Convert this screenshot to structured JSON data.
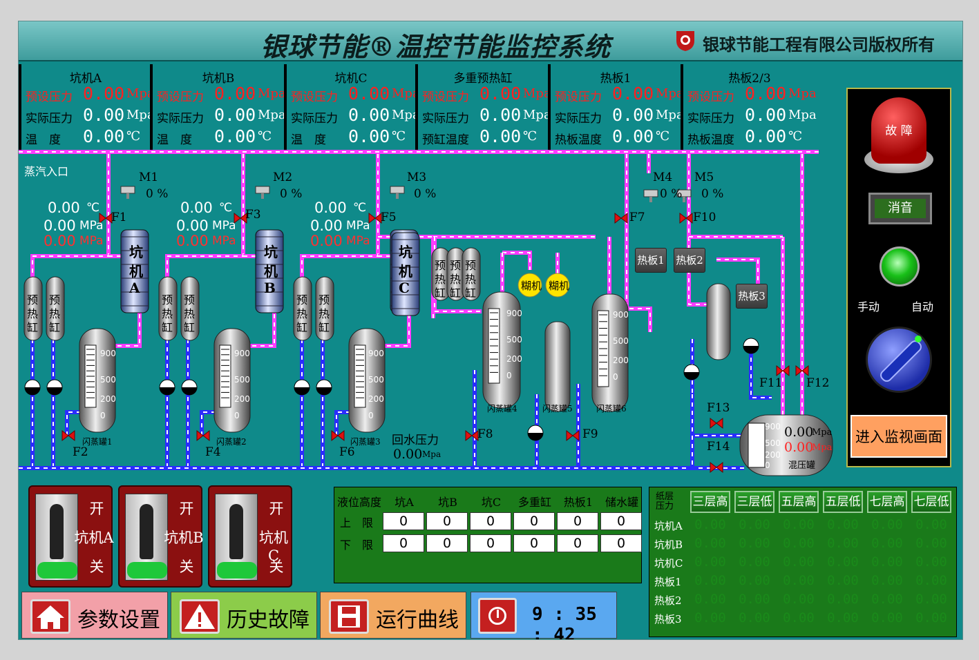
{
  "title": "银球节能®温控节能监控系统",
  "copyright": "银球节能工程有限公司版权所有",
  "panels": [
    {
      "name": "坑机A",
      "r1": "预设压力",
      "v1": "0.00",
      "u1": "Mpa",
      "r2": "实际压力",
      "v2": "0.00",
      "u2": "Mpa",
      "r3": "温　度",
      "v3": "0.00",
      "u3": "℃"
    },
    {
      "name": "坑机B",
      "r1": "预设压力",
      "v1": "0.00",
      "u1": "Mpa",
      "r2": "实际压力",
      "v2": "0.00",
      "u2": "Mpa",
      "r3": "温　度",
      "v3": "0.00",
      "u3": "℃"
    },
    {
      "name": "坑机C",
      "r1": "预设压力",
      "v1": "0.00",
      "u1": "Mpa",
      "r2": "实际压力",
      "v2": "0.00",
      "u2": "Mpa",
      "r3": "温　度",
      "v3": "0.00",
      "u3": "℃"
    },
    {
      "name": "多重预热缸",
      "r1": "预设压力",
      "v1": "0.00",
      "u1": "Mpa",
      "r2": "实际压力",
      "v2": "0.00",
      "u2": "Mpa",
      "r3": "预缸温度",
      "v3": "0.00",
      "u3": "℃"
    },
    {
      "name": "热板1",
      "r1": "预设压力",
      "v1": "0.00",
      "u1": "Mpa",
      "r2": "实际压力",
      "v2": "0.00",
      "u2": "Mpa",
      "r3": "热板温度",
      "v3": "0.00",
      "u3": "℃"
    },
    {
      "name": "热板2/3",
      "r1": "预设压力",
      "v1": "0.00",
      "u1": "Mpa",
      "r2": "实际压力",
      "v2": "0.00",
      "u2": "Mpa",
      "r3": "热板温度",
      "v3": "0.00",
      "u3": "℃"
    }
  ],
  "process": {
    "steam_inlet": "蒸汽入口",
    "motors": [
      {
        "name": "M1",
        "pct": "0 %"
      },
      {
        "name": "M2",
        "pct": "0 %"
      },
      {
        "name": "M3",
        "pct": "0 %"
      },
      {
        "name": "M4",
        "pct": "0 %"
      },
      {
        "name": "M5",
        "pct": "0 %"
      }
    ],
    "valves": [
      "F1",
      "F2",
      "F3",
      "F4",
      "F5",
      "F6",
      "F7",
      "F8",
      "F9",
      "F10",
      "F11",
      "F12",
      "F13",
      "F14"
    ],
    "readouts": [
      {
        "t": "0.00",
        "tu": "℃",
        "p": "0.00",
        "pu": "MPa",
        "s": "0.00",
        "su": "MPa"
      },
      {
        "t": "0.00",
        "tu": "℃",
        "p": "0.00",
        "pu": "MPa",
        "s": "0.00",
        "su": "MPa"
      },
      {
        "t": "0.00",
        "tu": "℃",
        "p": "0.00",
        "pu": "MPa",
        "s": "0.00",
        "su": "MPa"
      }
    ],
    "pit_labels": [
      [
        "坑",
        "机",
        "A"
      ],
      [
        "坑",
        "机",
        "B"
      ],
      [
        "坑",
        "机",
        "C"
      ]
    ],
    "preheat_label": [
      "预",
      "热",
      "缸"
    ],
    "flash_tanks": [
      "闪蒸罐1",
      "闪蒸罐2",
      "闪蒸罐3",
      "闪蒸罐4",
      "闪蒸罐5",
      "闪蒸罐6"
    ],
    "gauge_ticks": [
      "900",
      "500",
      "200",
      "0"
    ],
    "paste_machine": "糊机",
    "hotplates": [
      "热板1",
      "热板2",
      "热板3"
    ],
    "return_label": "回水压力",
    "return_value": "0.00",
    "return_unit": "Mpa",
    "mix_tank": {
      "name": "混压罐",
      "v1": "0.00",
      "u1": "Mpa",
      "v2": "0.00",
      "u2": "Mpa"
    }
  },
  "right_panel": {
    "fault_label": "故 障",
    "mute_label": "消音",
    "manual_label": "手动",
    "auto_label": "自动",
    "enter_label": "进入监视画面"
  },
  "switches": [
    {
      "on": "开",
      "name": "坑机A",
      "off": "关"
    },
    {
      "on": "开",
      "name": "坑机B",
      "off": "关"
    },
    {
      "on": "开",
      "name": "坑机C",
      "off": "关"
    }
  ],
  "level_table": {
    "title": "液位高度",
    "columns": [
      "坑A",
      "坑B",
      "坑C",
      "多重缸罐",
      "热板1",
      "储水罐"
    ],
    "rows": [
      {
        "label": "上　限",
        "values": [
          "0",
          "0",
          "0",
          "0",
          "0",
          "0"
        ]
      },
      {
        "label": "下　限",
        "values": [
          "0",
          "0",
          "0",
          "0",
          "0",
          "0"
        ]
      }
    ]
  },
  "pressure_table": {
    "title": "纸层压力",
    "columns": [
      "三层高",
      "三层低",
      "五层高",
      "五层低",
      "七层高",
      "七层低"
    ],
    "rows": [
      {
        "label": "坑机A",
        "values": [
          "0.00",
          "0.00",
          "0.00",
          "0.00",
          "0.00",
          "0.00"
        ]
      },
      {
        "label": "坑机B",
        "values": [
          "0.00",
          "0.00",
          "0.00",
          "0.00",
          "0.00",
          "0.00"
        ]
      },
      {
        "label": "坑机C",
        "values": [
          "0.00",
          "0.00",
          "0.00",
          "0.00",
          "0.00",
          "0.00"
        ]
      },
      {
        "label": "热板1",
        "values": [
          "0.00",
          "0.00",
          "0.00",
          "0.00",
          "0.00",
          "0.00"
        ]
      },
      {
        "label": "热板2",
        "values": [
          "0.00",
          "0.00",
          "0.00",
          "0.00",
          "0.00",
          "0.00"
        ]
      },
      {
        "label": "热板3",
        "values": [
          "0.00",
          "0.00",
          "0.00",
          "0.00",
          "0.00",
          "0.00"
        ]
      }
    ]
  },
  "nav": [
    {
      "label": "参数设置",
      "icon": "home-icon",
      "bg": "#f2a0a8"
    },
    {
      "label": "历史故障",
      "icon": "warning-icon",
      "bg": "#8ccc4a"
    },
    {
      "label": "运行曲线",
      "icon": "save-icon",
      "bg": "#f2a860"
    }
  ],
  "clock": {
    "time": "9 : 35 : 42",
    "icon": "clock-icon"
  }
}
